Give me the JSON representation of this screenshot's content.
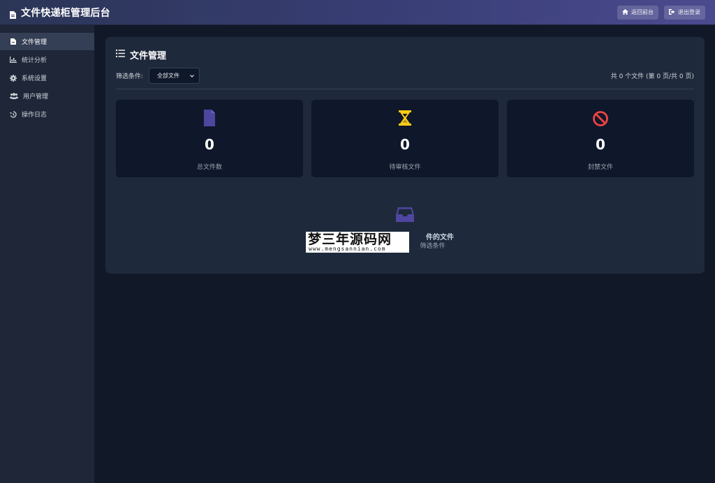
{
  "header": {
    "title": "文件快递柜管理后台",
    "buttons": [
      {
        "label": "返回前台",
        "icon": "home-icon"
      },
      {
        "label": "退出登录",
        "icon": "logout-icon"
      }
    ]
  },
  "sidebar": {
    "items": [
      {
        "label": "文件管理",
        "icon": "file-icon",
        "active": true
      },
      {
        "label": "统计分析",
        "icon": "chart-icon",
        "active": false
      },
      {
        "label": "系统设置",
        "icon": "gear-icon",
        "active": false
      },
      {
        "label": "用户管理",
        "icon": "users-icon",
        "active": false
      },
      {
        "label": "操作日志",
        "icon": "history-icon",
        "active": false
      }
    ]
  },
  "main": {
    "title": "文件管理",
    "filter_label": "筛选条件:",
    "filter_selected": "全部文件",
    "count_text": "共 0 个文件 (第 0 页/共 0 页)",
    "stats": [
      {
        "value": "0",
        "label": "总文件数",
        "icon": "file-icon",
        "color": "#4f46a0"
      },
      {
        "value": "0",
        "label": "待审核文件",
        "icon": "hourglass-icon",
        "color": "#facc15"
      },
      {
        "value": "0",
        "label": "封禁文件",
        "icon": "ban-icon",
        "color": "#ef4444"
      }
    ],
    "empty": {
      "icon": "inbox-icon",
      "title": "件的文件",
      "subtitle": "筛选条件"
    }
  },
  "watermark": {
    "main": "梦三年源码网",
    "sub": "www.mengsannian.com"
  }
}
